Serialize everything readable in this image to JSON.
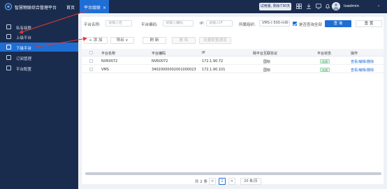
{
  "header": {
    "app_title": "智慧物联综合管理平台",
    "nav_home": "首页",
    "active_tab": "平台级联",
    "tab_close": "×",
    "trial": "试用版, 剩余730天",
    "username": "loadmin",
    "caret": "⌄"
  },
  "sidebar": {
    "items": [
      {
        "label": "私有级联"
      },
      {
        "label": "上级平台"
      },
      {
        "label": "下级平台"
      },
      {
        "label": "订阅管理"
      },
      {
        "label": "平台配置"
      }
    ]
  },
  "filters": {
    "name_label": "平台名称:",
    "name_placeholder": "请输入名",
    "code_label": "平台编码:",
    "code_placeholder": "请输入编码",
    "ip_label": "IP:",
    "ip_placeholder": "请输入IP",
    "org_label": "所属组织:",
    "org_value": "VMS-(-500-ml6-)",
    "include_sub": "是否查询全部",
    "query": "查 询",
    "reset": "重 置"
  },
  "toolbar": {
    "add": "+ 添 加",
    "export": "导出 ∨",
    "refresh": "刷 新",
    "delete": "删 除",
    "batch": "批量配置通道"
  },
  "table": {
    "columns": [
      "平台名称",
      "平台编码",
      "IP",
      "跨平台互联协议",
      "平台状态",
      "操作"
    ],
    "rows": [
      {
        "name": "NVR0072",
        "code": "NVR0072",
        "ip": "172.1.90.72",
        "protocol": "国标",
        "status": "在线",
        "action": "查看/编辑/删除"
      },
      {
        "name": "VMS",
        "code": "34020000002001000023",
        "ip": "172.1.90.101",
        "protocol": "国标",
        "status": "在线",
        "action": "查看/编辑/删除"
      }
    ]
  },
  "pagination": {
    "total": "共 2 条",
    "prev": "<",
    "page": "1",
    "next": ">",
    "size": "20 条/页"
  },
  "colors": {
    "brand": "#1f6ed4",
    "nav": "#1a2c4e",
    "annotation": "#e03a2e"
  }
}
